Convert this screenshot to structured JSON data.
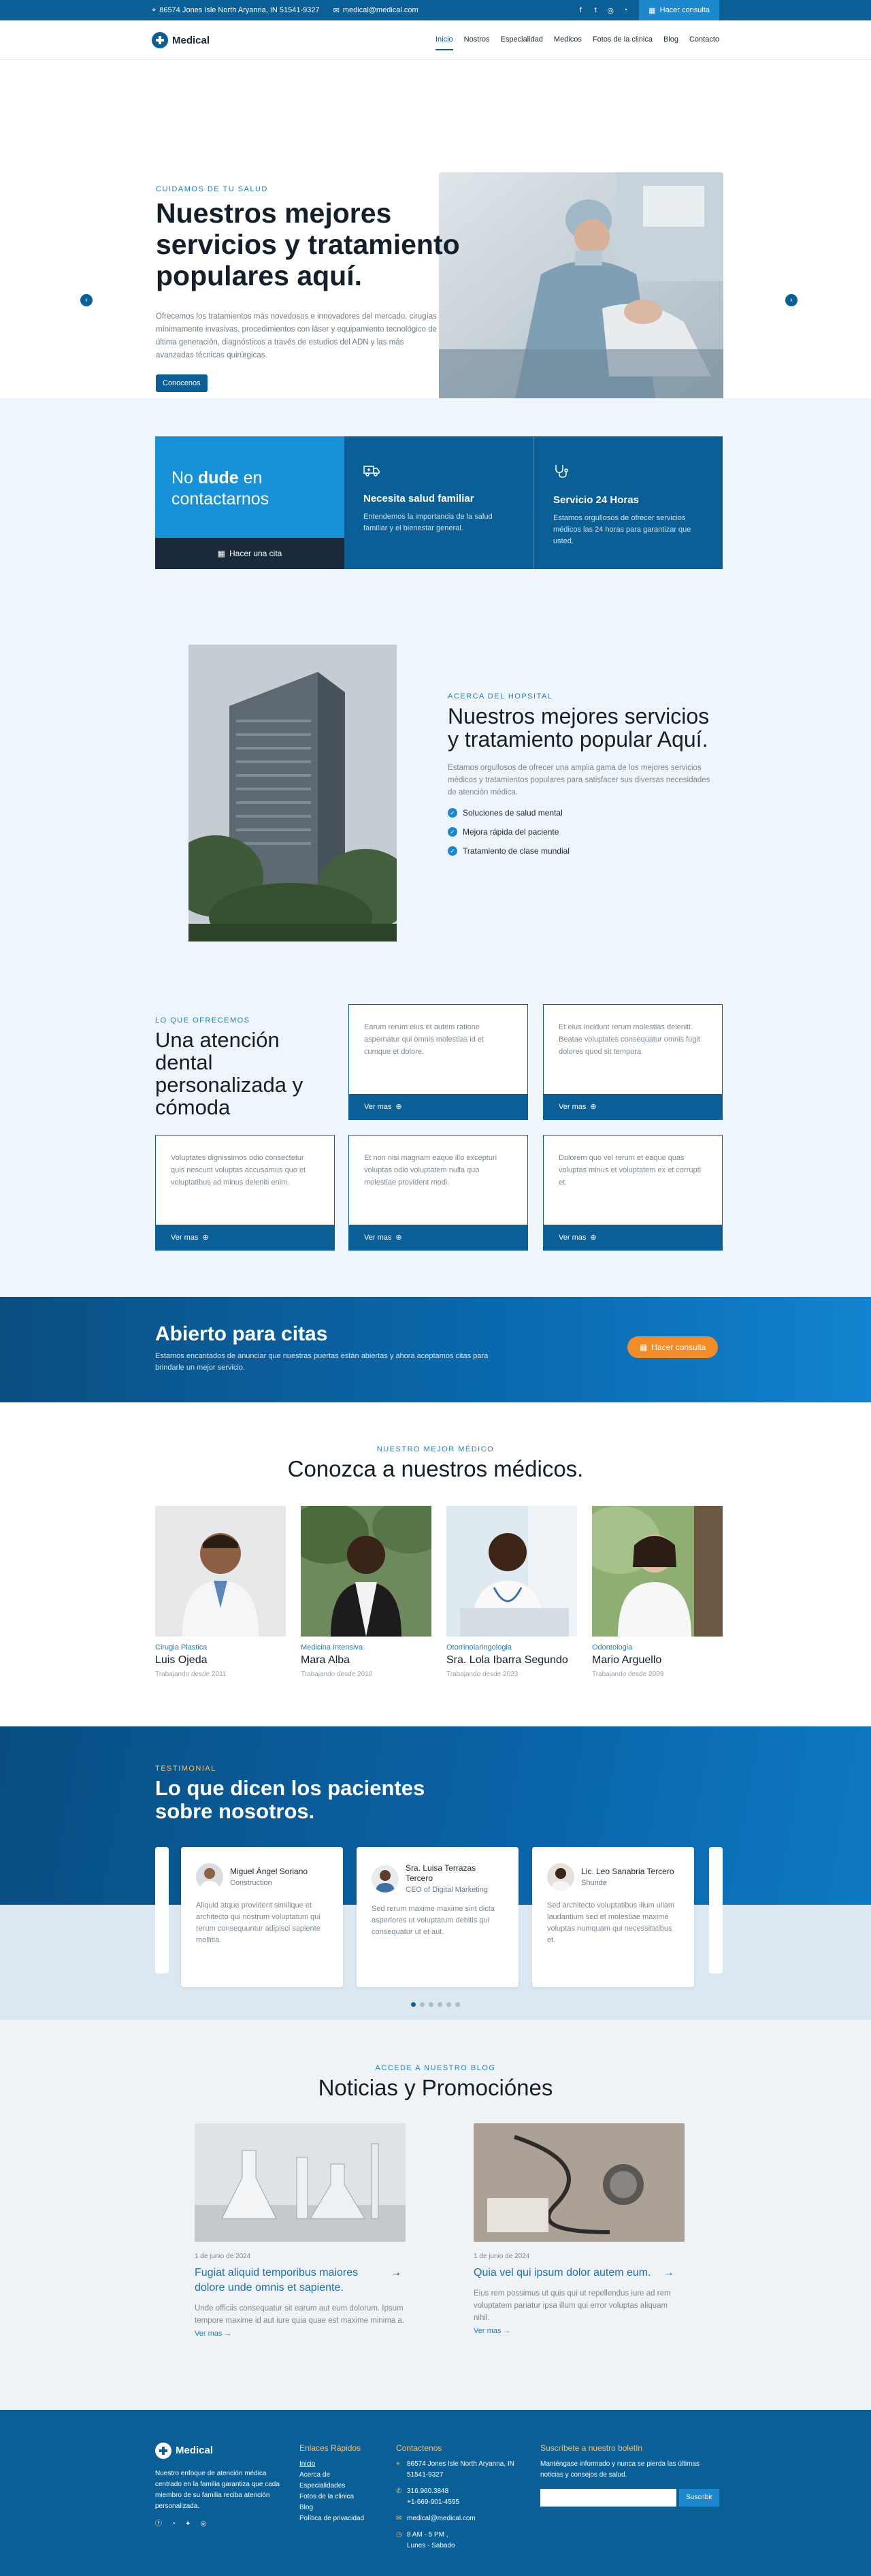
{
  "topbar": {
    "address": "86574 Jones Isle North Aryanna, IN 51541-9327",
    "email": "medical@medical.com",
    "consult_label": "Hacer consulta",
    "socials": [
      "facebook-icon",
      "twitter-icon",
      "instagram-icon",
      "whatsapp-icon"
    ]
  },
  "nav": {
    "brand": "Medical",
    "links": [
      "Inicio",
      "Nostros",
      "Especialidad",
      "Medicos",
      "Fotos de la clinica",
      "Blog",
      "Contacto"
    ],
    "active": "Inicio"
  },
  "hero": {
    "eyebrow": "CUIDAMOS DE TU SALUD",
    "title": "Nuestros mejores servicios y tratamiento populares aquí.",
    "description": "Ofrecemos los tratamientos más novedosos e innovadores del mercado, cirugías mínimamente invasivas, procedimientos con láser y equipamiento tecnológico de última generación, diagnósticos a través de estudios del ADN y las más avanzadas técnicas quirúrgicas.",
    "button": "Conocenos"
  },
  "features": {
    "headline_pre": "No ",
    "headline_bold": "dude",
    "headline_post": " en contactarnos",
    "appointment": "Hacer una cita",
    "cards": [
      {
        "title": "Necesita salud familiar",
        "text": "Entendemos la importancia de la salud familiar y el bienestar general."
      },
      {
        "title": "Servicio 24 Horas",
        "text": "Estamos orgullosos de ofrecer servicios médicos las 24 horas para garantizar que usted."
      }
    ]
  },
  "about": {
    "eyebrow": "ACERCA DEL HOPSITAL",
    "title": "Nuestros mejores servicios y tratamiento popular Aquí.",
    "text": "Estamos orgullosos de ofrecer una amplia gama de los mejores servicios médicos y tratamientos populares para satisfacer sus diversas necesidades de atención médica.",
    "checks": [
      "Soluciones de salud mental",
      "Mejora rápida del paciente",
      "Tratamiento de clase mundial"
    ]
  },
  "services": {
    "eyebrow": "LO QUE OFRECEMOS",
    "title": "Una atención dental personalizada y cómoda",
    "more_label": "Ver mas",
    "cards": [
      "Earum rerum eius et autem ratione aspernatur qui omnis molestias id et cumque et dolore.",
      "Et eius incidunt rerum molestias deleniti. Beatae voluptates consequatur omnis fugit dolores quod sit tempora.",
      "Voluptates dignissimos odio consectetur quis nescunt voluptas accusamus quo et voluptatibus ad minus deleniti enim.",
      "Et non nisi magnam eaque illo excepturi voluptas odio voluptatem nulla quo molestiae provident modi.",
      "Dolorem quo vel rerum et eaque quas voluptas minus et voluptatem ex et corrupti et."
    ]
  },
  "cta": {
    "title": "Abierto para citas",
    "text": "Estamos encantados de anunciar que nuestras puertas están abiertas y ahora aceptamos citas para brindarle un mejor servicio.",
    "button": "Hacer consulta"
  },
  "doctors": {
    "eyebrow": "NUESTRO MEJOR MÉDICO",
    "title": "Conozca a nuestros médicos.",
    "list": [
      {
        "specialty": "Cirugia Plastica",
        "name": "Luis Ojeda",
        "since": "Trabajando desde 2011"
      },
      {
        "specialty": "Medicina Intensiva",
        "name": "Mara Alba",
        "since": "Trabajando desde 2010"
      },
      {
        "specialty": "Otorrinolaringologia",
        "name": "Sra. Lola Ibarra Segundo",
        "since": "Trabajando desde 2023"
      },
      {
        "specialty": "Odontologia",
        "name": "Mario Arguello",
        "since": "Trabajando desde 2009"
      }
    ]
  },
  "testimonials": {
    "eyebrow": "TESTIMONIAL",
    "title": "Lo que dicen los pacientes sobre nosotros.",
    "list": [
      {
        "name": "Miguel Ángel Soriano",
        "role": "Construction",
        "text": "Aliquid atque provident similique et architecto qui nostrum voluptatum qui rerum consequuntur adipisci sapiente mollitia."
      },
      {
        "name": "Sra. Luisa Terrazas Tercero",
        "role": "CEO of Digital Marketing",
        "text": "Sed rerum maxime maxime sint dicta asperiores ut voluptatum debitis qui consequatur ut et aut."
      },
      {
        "name": "Lic. Leo Sanabria Tercero",
        "role": "Shunde",
        "text": "Sed architecto voluptatibus illum ullam laudantium sed et molestiae maxime voluptas numquam qui necessitatibus et."
      }
    ],
    "dots": 6,
    "active_dot": 0
  },
  "blog": {
    "eyebrow": "ACCEDE A NUESTRO BLOG",
    "title": "Noticias y Promociónes",
    "more_label": "Ver mas",
    "posts": [
      {
        "date": "1 de junio de 2024",
        "title": "Fugiat aliquid temporibus maiores dolore unde omnis et sapiente.",
        "excerpt": "Unde officiis consequatur sit earum aut eum dolorum. Ipsum tempore maxime id aut iure quia quae est maxime minima a."
      },
      {
        "date": "1 de junio de 2024",
        "title": "Quia vel qui ipsum dolor autem eum.",
        "excerpt": "Eius rem possimus ut quis qui ut repellendus iure ad rem voluptatem pariatur ipsa illum qui error voluptas aliquam nihil."
      }
    ]
  },
  "footer": {
    "brand": "Medical",
    "about": "Nuestro enfoque de atención médica centrado en la familia garantiza que cada miembro de su familia reciba atención personalizada.",
    "links_title": "Enlaces Rápidos",
    "links": [
      "Inicio",
      "Acerca de",
      "Especialidades",
      "Fotos de la clinica",
      "Blog",
      "Política de privacidad"
    ],
    "contact_title": "Contactenos",
    "contact": {
      "address": "86574 Jones Isle North Aryanna, IN 51541-9327",
      "phone1": "316.960.3848",
      "phone2": "+1-669-901-4595",
      "email": "medical@medical.com",
      "hours": "8 AM - 5 PM ,",
      "days": "Lunes - Sabado"
    },
    "newsletter_title": "Suscríbete a nuestro boletín",
    "newsletter_text": "Manténgase informado y nunca se pierda las últimas noticias y consejos de salud.",
    "subscribe": "Suscribir"
  }
}
